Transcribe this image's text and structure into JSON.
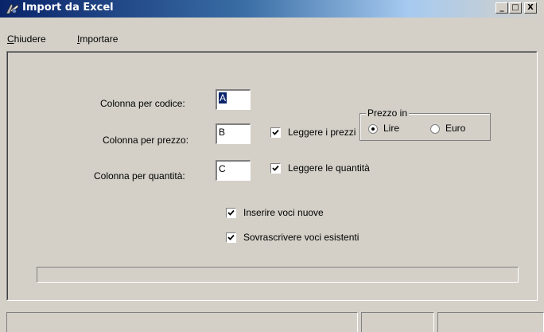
{
  "window": {
    "title": "Import da Excel",
    "controls": {
      "minimize": "_",
      "maximize": "□",
      "close": "X"
    },
    "title_gradient": [
      "#0a246a",
      "#a6caf0"
    ]
  },
  "menu": [
    {
      "access_key": "C",
      "rest": "hiudere"
    },
    {
      "access_key": "I",
      "rest": "mportare"
    }
  ],
  "form": {
    "codice": {
      "label": "Colonna per codice:",
      "value": "A"
    },
    "prezzo": {
      "label": "Colonna per prezzo:",
      "value": "B"
    },
    "quantita": {
      "label": "Colonna per quantità:",
      "value": "C"
    },
    "leggere_prezzi": {
      "label": "Leggere i prezzi",
      "checked": true
    },
    "leggere_quantita": {
      "label": "Leggere le quantità",
      "checked": true
    },
    "inserire_voci": {
      "label": "Inserire voci nuove",
      "checked": true
    },
    "sovrascrivere_voci": {
      "label": "Sovrascrivere voci esistenti",
      "checked": true
    },
    "prezzo_in": {
      "legend": "Prezzo in",
      "options": [
        {
          "label": "Lire",
          "selected": true
        },
        {
          "label": "Euro",
          "selected": false
        }
      ]
    }
  },
  "progress": {
    "value": 0
  },
  "statusbar": {
    "panes": [
      "",
      "",
      ""
    ]
  }
}
